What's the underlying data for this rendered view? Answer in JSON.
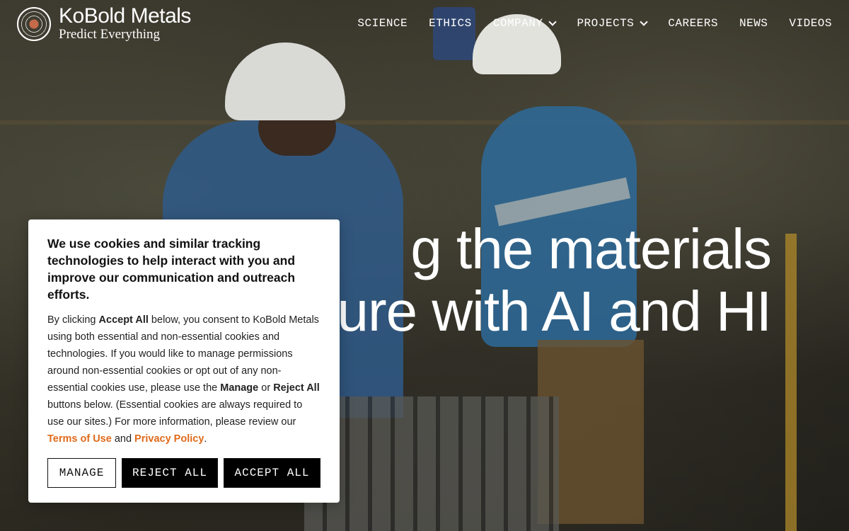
{
  "brand": {
    "name": "KoBold Metals",
    "tagline": "Predict Everything"
  },
  "nav": {
    "items": [
      {
        "label": "SCIENCE",
        "dropdown": false
      },
      {
        "label": "ETHICS",
        "dropdown": false
      },
      {
        "label": "COMPANY",
        "dropdown": true
      },
      {
        "label": "PROJECTS",
        "dropdown": true
      },
      {
        "label": "CAREERS",
        "dropdown": false
      },
      {
        "label": "NEWS",
        "dropdown": false
      },
      {
        "label": "VIDEOS",
        "dropdown": false
      }
    ]
  },
  "hero": {
    "line1": "g the materials",
    "line2": "ure with AI and HI"
  },
  "cookie": {
    "title": "We use cookies and similar tracking technologies to help interact with you and improve our communication and outreach efforts.",
    "body_1": "By clicking ",
    "accept_all_ref": "Accept All",
    "body_2": " below, you consent to KoBold Metals using both essential and non-essential cookies and technologies. If you would like to manage permissions around non-essential cookies or opt out of any non-essential cookies use, please use the ",
    "manage_ref": "Manage",
    "body_3": " or ",
    "reject_all_ref": "Reject All",
    "body_4": " buttons below. (Essential cookies are always required to use our sites.) For more information, please review our ",
    "terms_link": "Terms of Use",
    "body_5": " and ",
    "privacy_link": "Privacy Policy",
    "body_6": ".",
    "manage_button": "MANAGE",
    "reject_button": "REJECT ALL",
    "accept_button": "ACCEPT ALL"
  },
  "colors": {
    "link_accent": "#e06a1a",
    "button_dark": "#000000",
    "text_white": "#ffffff"
  }
}
